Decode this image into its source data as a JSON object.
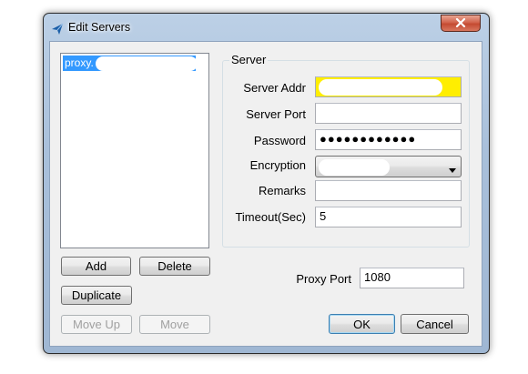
{
  "window": {
    "title": "Edit Servers"
  },
  "server_list": {
    "items": [
      {
        "label": "proxy."
      }
    ]
  },
  "list_buttons": {
    "add": "Add",
    "delete": "Delete",
    "duplicate": "Duplicate",
    "move_up": "Move Up",
    "move_down": "Move"
  },
  "server_group": {
    "title": "Server",
    "fields": {
      "server_addr": {
        "label": "Server Addr",
        "value": ""
      },
      "server_port": {
        "label": "Server Port",
        "value": ""
      },
      "password": {
        "label": "Password",
        "value": "●●●●●●●●●●●●"
      },
      "encryption": {
        "label": "Encryption",
        "value": ""
      },
      "remarks": {
        "label": "Remarks",
        "value": ""
      },
      "timeout": {
        "label": "Timeout(Sec)",
        "value": "5"
      }
    }
  },
  "proxy_port": {
    "label": "Proxy Port",
    "value": "1080"
  },
  "dialog_buttons": {
    "ok": "OK",
    "cancel": "Cancel"
  },
  "colors": {
    "selection": "#3399ff",
    "highlight_field": "#ffee00",
    "close_button": "#c44a31"
  },
  "icons": {
    "app": "paper-plane-icon",
    "close": "close-x-icon",
    "dropdown": "triangle-down-icon"
  }
}
